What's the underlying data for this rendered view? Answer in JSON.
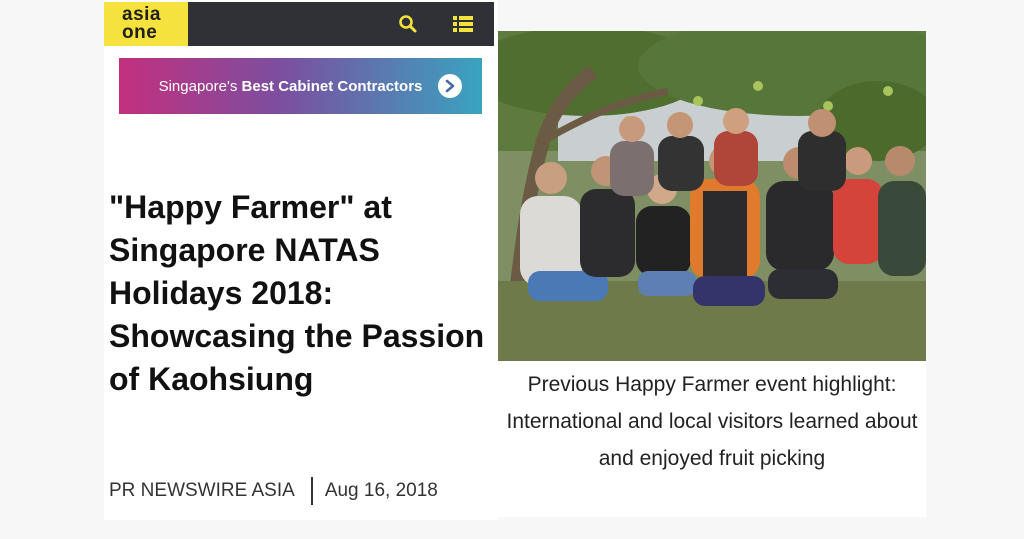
{
  "header": {
    "logo_line1": "asia",
    "logo_line2": "one",
    "search_icon": "search-icon",
    "menu_icon": "list-menu-icon",
    "accent_color": "#f6e23c",
    "bar_color": "#2f3136"
  },
  "banner": {
    "text_prefix": "Singapore's ",
    "text_bold": "Best Cabinet Contractors",
    "arrow_icon": "chevron-right-icon"
  },
  "article": {
    "title": "\"Happy Farmer\" at Singapore NATAS Holidays 2018: Showcasing the Passion of Kaohsiung",
    "source": "PR NEWSWIRE ASIA",
    "date": "Aug 16, 2018"
  },
  "photo": {
    "caption": "Previous Happy Farmer event highlight: International and local visitors learned about and enjoyed fruit picking"
  }
}
